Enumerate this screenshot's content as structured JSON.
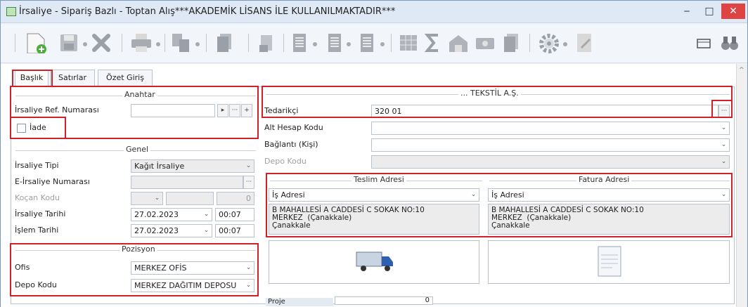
{
  "window": {
    "title": "İrsaliye - Sipariş Bazlı - Toptan Alış***AKADEMİK LİSANS İLE KULLANILMAKTADIR***",
    "minimize": "‒",
    "maximize": "□",
    "close": "✕"
  },
  "tabs": [
    "Başlık",
    "Satırlar",
    "Özet Giriş"
  ],
  "anahtar": {
    "title": "Anahtar",
    "ref_label": "İrsaliye Ref. Numarası",
    "ref_value": "",
    "iade_label": "İade"
  },
  "genel": {
    "title": "Genel",
    "tip_label": "İrsaliye Tipi",
    "tip_value": "Kağıt İrsaliye",
    "eirs_label": "E-İrsaliye Numarası",
    "eirs_value": "",
    "kocan_label": "Koçan Kodu",
    "kocan_number": "0",
    "tarih_label": "İrsaliye Tarihi",
    "tarih_value": "27.02.2023",
    "tarih_time": "00:07",
    "islem_label": "İşlem Tarihi",
    "islem_value": "27.02.2023",
    "islem_time": "00:07"
  },
  "pozisyon": {
    "title": "Pozisyon",
    "ofis_label": "Ofis",
    "ofis_value": "MERKEZ OFİS",
    "depo_label": "Depo Kodu",
    "depo_value": "MERKEZ DAĞITIM DEPOSU"
  },
  "supplier": {
    "title": "... TEKSTİL A.Ş.",
    "tedarikci_label": "Tedarikçi",
    "tedarikci_value": "320 01",
    "alt_label": "Alt Hesap Kodu",
    "baglanti_label": "Bağlantı (Kişi)",
    "depo_label": "Depo Kodu"
  },
  "teslim": {
    "title": "Teslim Adresi",
    "type": "İş Adresi",
    "address": "B MAHALLESİ A CADDESİ C SOKAK NO:10\nMERKEZ  (Çanakkale)\nÇanakkale"
  },
  "fatura": {
    "title": "Fatura Adresi",
    "type": "İş Adresi",
    "address": "B MAHALLESİ A CADDESİ C SOKAK NO:10\nMERKEZ  (Çanakkale)\nÇanakkale"
  },
  "bottom": {
    "partial_label": "Proje",
    "partial_value": "0"
  },
  "colors": {
    "highlight": "#d0202a",
    "titlebar": "#dfe9f5"
  }
}
